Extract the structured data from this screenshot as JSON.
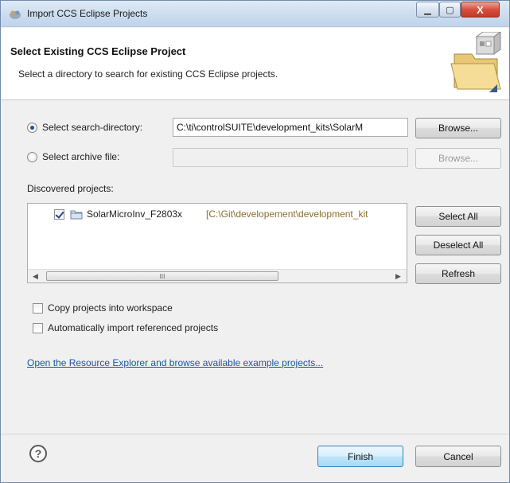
{
  "window": {
    "title": "Import CCS Eclipse Projects",
    "minimize_glyph": "▁",
    "maximize_glyph": "▢",
    "close_glyph": "X"
  },
  "banner": {
    "title": "Select Existing CCS Eclipse Project",
    "description": "Select a directory to search for existing CCS Eclipse projects."
  },
  "source": {
    "search_directory_label": "Select search-directory:",
    "search_directory_selected": true,
    "search_directory_value": "C:\\ti\\controlSUITE\\development_kits\\SolarM",
    "archive_label": "Select archive file:",
    "archive_value": "",
    "browse_label": "Browse...",
    "browse_archive_label": "Browse..."
  },
  "discovered": {
    "label": "Discovered projects:",
    "projects": [
      {
        "checked": true,
        "name": "SolarMicroInv_F2803x",
        "path": "[C:\\Git\\developement\\development_kit"
      }
    ],
    "scroll_thumb_glyph": "III",
    "scroll_left_glyph": "◀",
    "scroll_right_glyph": "▶"
  },
  "list_buttons": {
    "select_all": "Select All",
    "deselect_all": "Deselect All",
    "refresh": "Refresh"
  },
  "options": {
    "copy_projects": {
      "label": "Copy projects into workspace",
      "checked": false
    },
    "auto_import": {
      "label": "Automatically import referenced projects",
      "checked": false
    }
  },
  "resource_link": "Open the Resource Explorer and browse available example projects...",
  "footer": {
    "help_glyph": "?",
    "finish": "Finish",
    "cancel": "Cancel"
  },
  "colors": {
    "link": "#1a56a8",
    "project_path": "#8b6f2e",
    "selection_accent": "#1f4fa3"
  }
}
